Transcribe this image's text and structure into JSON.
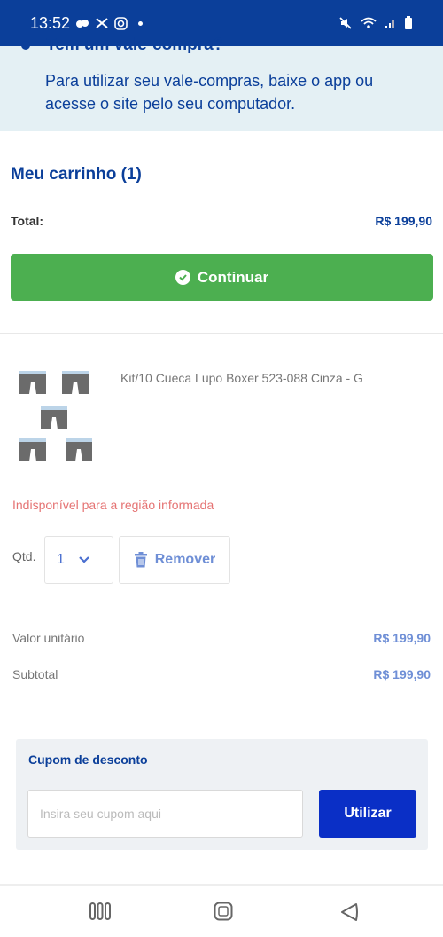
{
  "status_bar": {
    "time": "13:52"
  },
  "banner": {
    "partial_title": "Tem um vale-compra?",
    "text": "Para utilizar seu vale-compras, baixe o app ou acesse o site pelo seu computador."
  },
  "cart": {
    "title": "Meu carrinho (1)",
    "total_label": "Total:",
    "total_value": "R$ 199,90",
    "continue_label": "Continuar"
  },
  "product": {
    "name": "Kit/10 Cueca Lupo Boxer 523-088 Cinza - G",
    "availability": "Indisponível para a região informada",
    "qty_label": "Qtd.",
    "qty_value": "1",
    "remove_label": "Remover",
    "unit_label": "Valor unitário",
    "unit_value": "R$ 199,90",
    "subtotal_label": "Subtotal",
    "subtotal_value": "R$ 199,90"
  },
  "coupon": {
    "title": "Cupom de desconto",
    "placeholder": "Insira seu cupom aqui",
    "value": "",
    "button_label": "Utilizar"
  },
  "colors": {
    "primary": "#0b3f9a",
    "success": "#4caf50",
    "error": "#e57373",
    "button_blue": "#0a2fc6"
  }
}
